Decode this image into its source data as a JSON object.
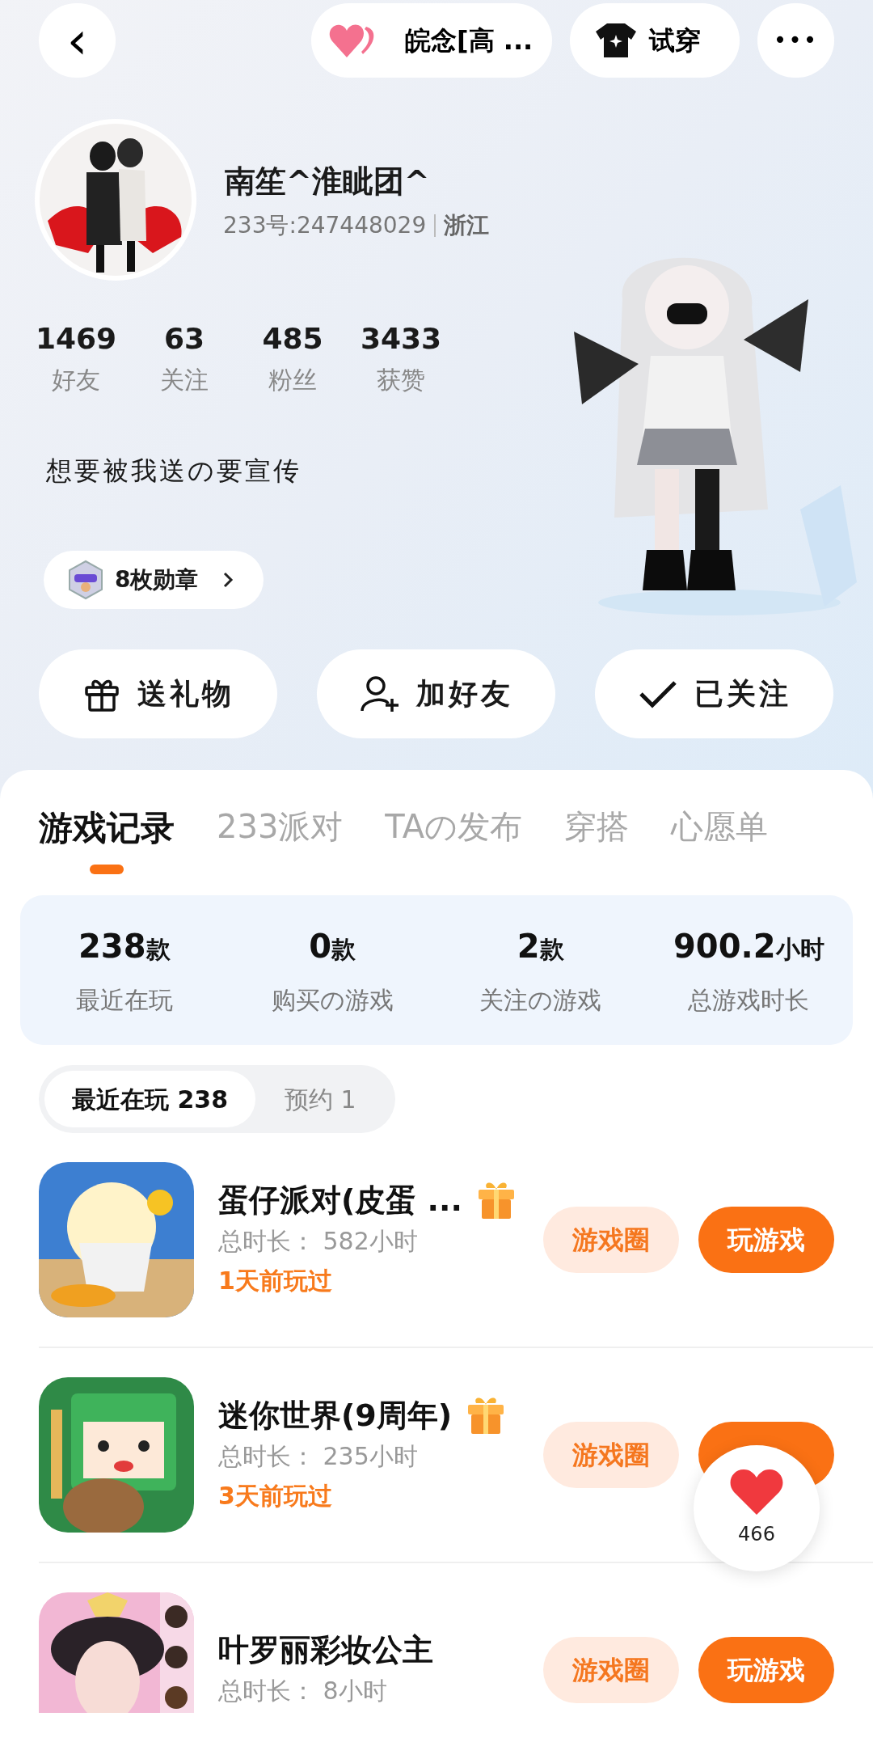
{
  "top_bar": {
    "back": "‹",
    "ship": {
      "label": "皖念[高 ..."
    },
    "try_on": {
      "label": "试穿"
    },
    "more": "•••"
  },
  "profile": {
    "name": "南笙^淮眦团^",
    "id": "233号:247448029",
    "region": "浙江",
    "stats": [
      {
        "value": "1469",
        "label": "好友"
      },
      {
        "value": "63",
        "label": "关注"
      },
      {
        "value": "485",
        "label": "粉丝"
      },
      {
        "value": "3433",
        "label": "获赞"
      }
    ],
    "bio": "想要被我送の要宣传",
    "medals": "8枚勋章"
  },
  "actions": [
    {
      "kind": "gift",
      "label": "送礼物"
    },
    {
      "kind": "add",
      "label": "加好友"
    },
    {
      "kind": "check",
      "label": "已关注"
    }
  ],
  "tabs": [
    {
      "label": "游戏记录",
      "selected": true
    },
    {
      "label": "233派对",
      "selected": false
    },
    {
      "label": "TAの发布",
      "selected": false
    },
    {
      "label": "穿搭",
      "selected": false
    },
    {
      "label": "心愿单",
      "selected": false
    }
  ],
  "summary": [
    {
      "value": "238",
      "unit": "款",
      "label": "最近在玩"
    },
    {
      "value": "0",
      "unit": "款",
      "label": "购买の游戏"
    },
    {
      "value": "2",
      "unit": "款",
      "label": "关注の游戏"
    },
    {
      "value": "900.2",
      "unit": "小时",
      "label": "总游戏时长"
    }
  ],
  "sub_tabs": [
    {
      "label": "最近在玩 238",
      "selected": true
    },
    {
      "label": "预约 1",
      "selected": false
    }
  ],
  "games": [
    {
      "title": "蛋仔派对(皮蛋 ...",
      "gift": true,
      "duration": "总时长： 582小时",
      "last_played": "1天前玩过",
      "circle": "游戏圈",
      "play": "玩游戏"
    },
    {
      "title": "迷你世界(9周年)",
      "gift": true,
      "duration": "总时长： 235小时",
      "last_played": "3天前玩过",
      "circle": "游戏圈"
    },
    {
      "title": "叶罗丽彩妆公主",
      "gift": false,
      "duration": "总时长： 8小时",
      "circle": "游戏圈",
      "play": "玩游戏"
    }
  ],
  "like_button": {
    "count": "466"
  }
}
